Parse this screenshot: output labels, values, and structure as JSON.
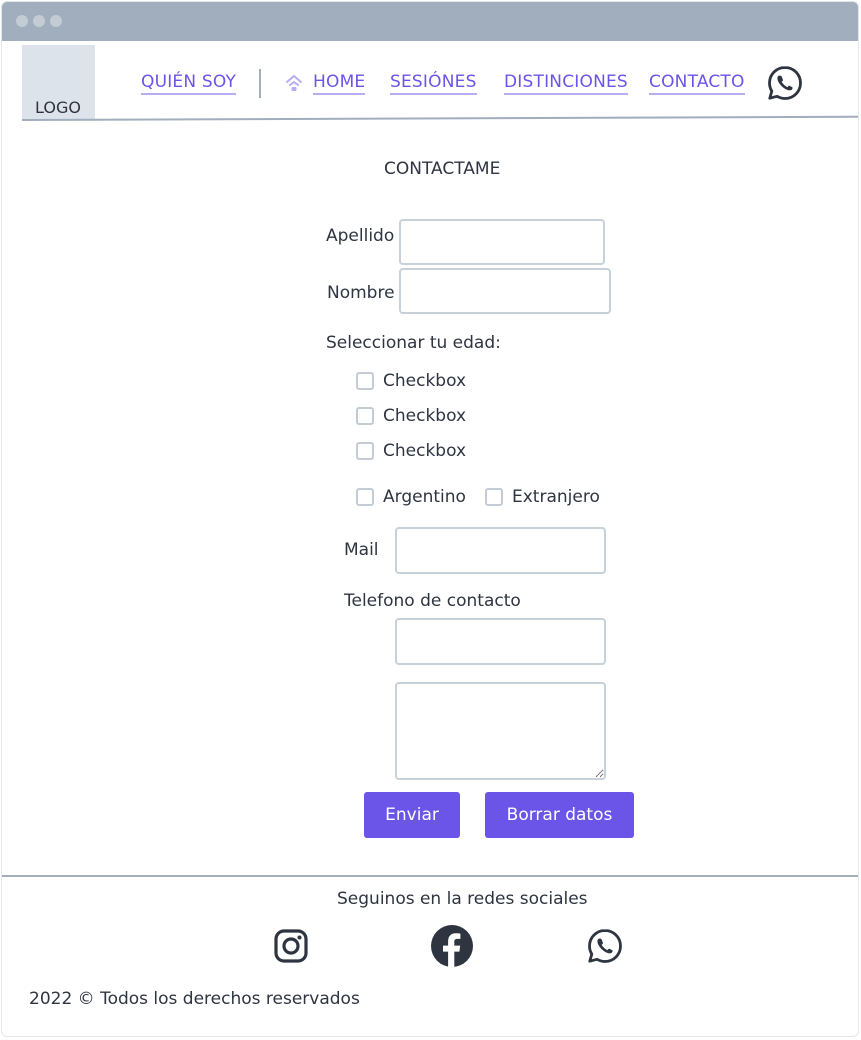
{
  "header": {
    "logo_text": "LOGO",
    "nav": [
      {
        "label": "QUIÉN SOY"
      },
      {
        "label": "HOME"
      },
      {
        "label": "SESIÓNES"
      },
      {
        "label": "DISTINCIONES"
      },
      {
        "label": "CONTACTO"
      }
    ],
    "icons": {
      "home": "home-icon",
      "whatsapp": "whatsapp-icon"
    }
  },
  "form": {
    "title": "CONTACTAME",
    "apellido_label": "Apellido",
    "apellido_value": "",
    "nombre_label": "Nombre",
    "nombre_value": "",
    "edad_label": "Seleccionar tu edad:",
    "age_checkboxes": [
      "Checkbox",
      "Checkbox",
      "Checkbox"
    ],
    "nationality": [
      "Argentino",
      "Extranjero"
    ],
    "mail_label": "Mail",
    "mail_value": "",
    "telefono_label": "Telefono de contacto",
    "telefono_value": "",
    "message_value": "",
    "submit_label": "Enviar",
    "reset_label": "Borrar datos"
  },
  "footer": {
    "social_title": "Seguinos en la redes sociales",
    "icons": [
      "instagram-icon",
      "facebook-icon",
      "whatsapp-icon"
    ],
    "copyright": "2022 © Todos los derechos reservados"
  },
  "colors": {
    "accent": "#6a55e8",
    "titlebar": "#a0aebd",
    "text": "#2e3440",
    "border": "#c8d0d8"
  }
}
